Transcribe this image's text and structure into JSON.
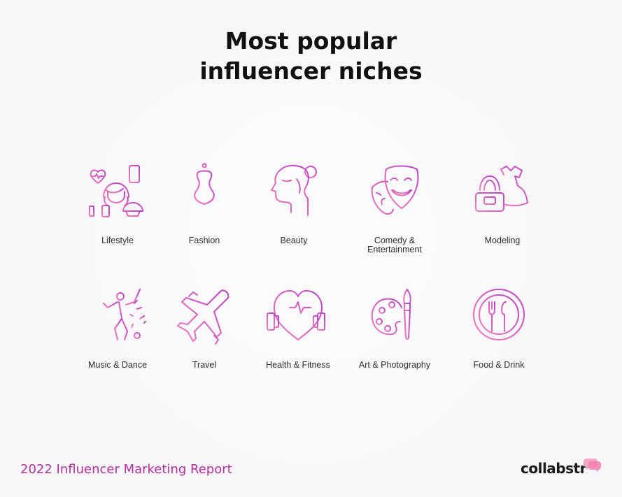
{
  "title_line1": "Most popular",
  "title_line2": "influencer niches",
  "niches": [
    {
      "label": "Lifestyle",
      "icon": "lifestyle-icon"
    },
    {
      "label": "Fashion",
      "icon": "mannequin-icon"
    },
    {
      "label": "Beauty",
      "icon": "face-profile-icon"
    },
    {
      "label": "Comedy &",
      "label2": "Entertainment",
      "icon": "theater-masks-icon"
    },
    {
      "label": "Modeling",
      "icon": "dress-handbag-icon"
    },
    {
      "label": "Music & Dance",
      "icon": "dancer-icon"
    },
    {
      "label": "Travel",
      "icon": "airplane-icon"
    },
    {
      "label": "Health & Fitness",
      "icon": "heart-dumbbell-icon"
    },
    {
      "label": "Art & Photography",
      "icon": "palette-icon"
    },
    {
      "label": "Food & Drink",
      "icon": "plate-cutlery-icon"
    }
  ],
  "footer": {
    "report": "2022 Influencer Marketing Report",
    "brand": "collabstr"
  },
  "colors": {
    "icon_gradient_start": "#f27fb8",
    "icon_gradient_end": "#b640c8",
    "report_text": "#b0309f",
    "brand_bubble": "#f48fb8"
  }
}
